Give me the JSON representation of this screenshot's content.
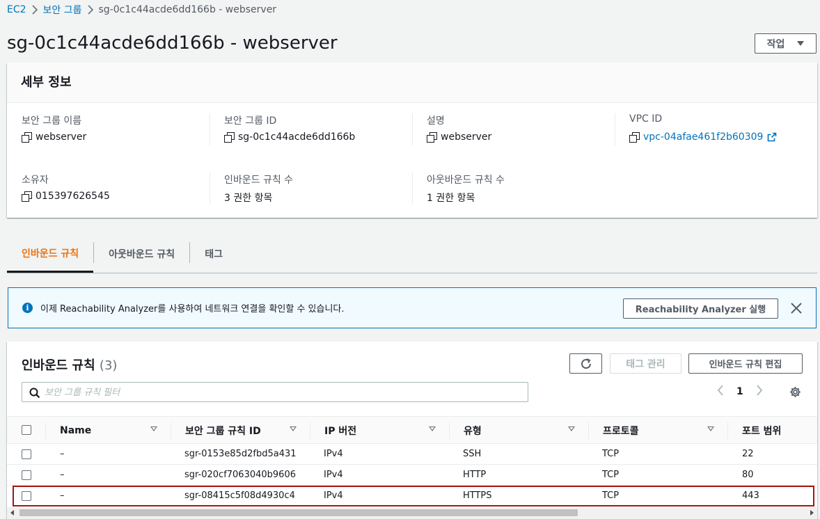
{
  "breadcrumb": {
    "root": "EC2",
    "parent": "보안 그룹",
    "current": "sg-0c1c44acde6dd166b - webserver"
  },
  "page": {
    "title": "sg-0c1c44acde6dd166b - webserver",
    "actions_label": "작업"
  },
  "details": {
    "header": "세부 정보",
    "fields": {
      "sg_name": {
        "label": "보안 그룹 이름",
        "value": "webserver"
      },
      "sg_id": {
        "label": "보안 그룹 ID",
        "value": "sg-0c1c44acde6dd166b"
      },
      "description": {
        "label": "설명",
        "value": "webserver"
      },
      "vpc_id": {
        "label": "VPC ID",
        "value": "vpc-04afae461f2b60309"
      },
      "owner": {
        "label": "소유자",
        "value": "015397626545"
      },
      "inbound_count": {
        "label": "인바운드 규칙 수",
        "value": "3 권한 항목"
      },
      "outbound_count": {
        "label": "아웃바운드 규칙 수",
        "value": "1 권한 항목"
      }
    }
  },
  "tabs": [
    "인바운드 규칙",
    "아웃바운드 규칙",
    "태그"
  ],
  "banner": {
    "text": "이제 Reachability Analyzer를 사용하여 네트워크 연결을 확인할 수 있습니다.",
    "button": "Reachability Analyzer 실행"
  },
  "rules": {
    "title": "인바운드 규칙",
    "count": "(3)",
    "tag_button": "태그 관리",
    "edit_button": "인바운드 규칙 편집",
    "filter_placeholder": "보안 그룹 규칙 필터",
    "page": "1",
    "columns": [
      "Name",
      "보안 그룹 규칙 ID",
      "IP 버전",
      "유형",
      "프로토콜",
      "포트 범위"
    ],
    "rows": [
      {
        "name": "–",
        "id": "sgr-0153e85d2fbd5a431",
        "ip": "IPv4",
        "type": "SSH",
        "protocol": "TCP",
        "port": "22"
      },
      {
        "name": "–",
        "id": "sgr-020cf7063040b9606",
        "ip": "IPv4",
        "type": "HTTP",
        "protocol": "TCP",
        "port": "80"
      },
      {
        "name": "–",
        "id": "sgr-08415c5f08d4930c4",
        "ip": "IPv4",
        "type": "HTTPS",
        "protocol": "TCP",
        "port": "443"
      }
    ]
  },
  "colors": {
    "link": "#0073bb",
    "active_tab": "#ec7211",
    "selection_outline": "#a31515"
  }
}
